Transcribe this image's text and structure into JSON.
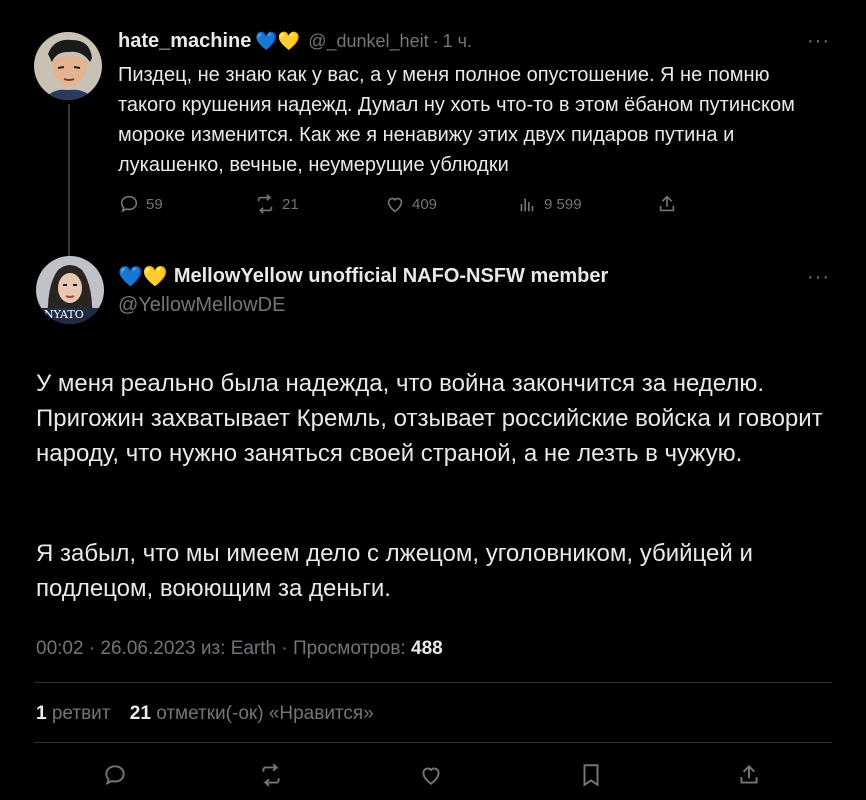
{
  "parent": {
    "display_name": "hate_machine",
    "name_emoji": "💙💛",
    "handle": "@_dunkel_heit",
    "separator": "·",
    "time": "1 ч.",
    "more": "···",
    "text": "Пиздец, не знаю как у вас, а у меня полное опустошение. Я не помню такого крушения надежд. Думал ну хоть что-то в этом ёбаном путинском мороке изменится. Как же я ненавижу этих двух пидаров путина и лукашенко, вечные, неумерущие ублюдки",
    "stats": {
      "replies": "59",
      "retweets": "21",
      "likes": "409",
      "views": "9 599"
    }
  },
  "main": {
    "name_emoji": "💙💛",
    "display_name": "MellowYellow unofficial NAFO-NSFW member",
    "handle": "@YellowMellowDE",
    "more": "···",
    "avatar_badge": "NYATO",
    "paragraph1": "У меня реально была надежда, что война закончится за неделю. Пригожин захватывает Кремль, отзывает российские войска и говорит народу, что нужно заняться своей страной, а не лезть в чужую.",
    "paragraph2": "Я забыл, что мы имеем дело с лжецом, уголовником, убийцей и подлецом, воюющим за деньги.",
    "meta": {
      "time": "00:02",
      "date": "26.06.2023",
      "source": "из: Earth",
      "views_label": "Просмотров:",
      "views": "488"
    },
    "counts": {
      "retweets": "1",
      "retweets_label": "ретвит",
      "likes": "21",
      "likes_label": "отметки(-ок) «Нравится»"
    }
  },
  "icons": [
    "reply-icon",
    "retweet-icon",
    "like-icon",
    "views-icon",
    "share-icon",
    "bookmark-icon",
    "more-icon"
  ],
  "colors": {
    "background": "#000000",
    "text": "#e7e9ea",
    "muted": "#71767b",
    "divider": "#2f3336"
  }
}
